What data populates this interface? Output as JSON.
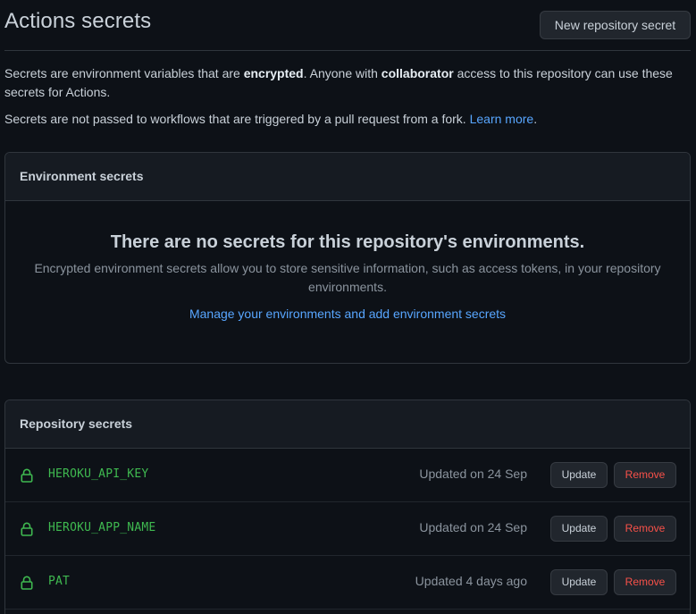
{
  "header": {
    "title": "Actions secrets",
    "new_button": "New repository secret"
  },
  "description": {
    "p1_a": "Secrets are environment variables that are ",
    "p1_b": "encrypted",
    "p1_c": ". Anyone with ",
    "p1_d": "collaborator",
    "p1_e": " access to this repository can use these secrets for Actions.",
    "p2_a": "Secrets are not passed to workflows that are triggered by a pull request from a fork. ",
    "p2_link": "Learn more",
    "p2_b": "."
  },
  "environment": {
    "header": "Environment secrets",
    "empty_title": "There are no secrets for this repository's environments.",
    "empty_text": "Encrypted environment secrets allow you to store sensitive information, such as access tokens, in your repository environments.",
    "empty_link": "Manage your environments and add environment secrets"
  },
  "repository": {
    "header": "Repository secrets",
    "update_label": "Update",
    "remove_label": "Remove",
    "secrets": [
      {
        "name": "HEROKU_API_KEY",
        "updated": "Updated on 24 Sep"
      },
      {
        "name": "HEROKU_APP_NAME",
        "updated": "Updated on 24 Sep"
      },
      {
        "name": "PAT",
        "updated": "Updated 4 days ago"
      }
    ]
  },
  "colors": {
    "background": "#0d1117",
    "accent_link": "#58a6ff",
    "secret_green": "#3fb950",
    "danger": "#f85149"
  },
  "icons": {
    "lock": "lock-icon"
  }
}
